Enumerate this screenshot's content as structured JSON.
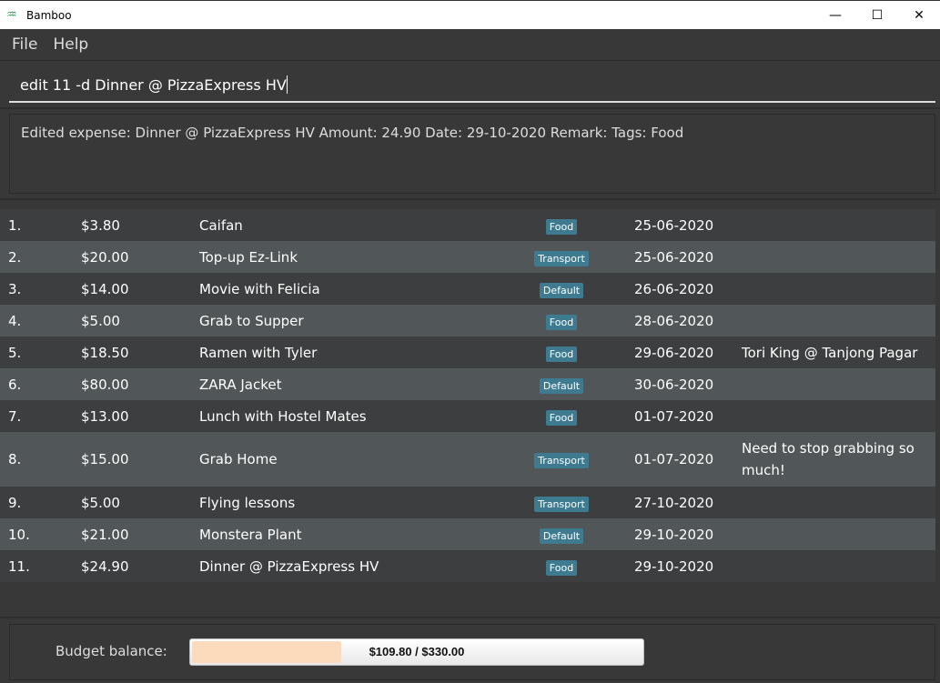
{
  "window": {
    "title": "Bamboo",
    "icon": "bamboo-icon",
    "controls": [
      "minimize-icon",
      "maximize-icon",
      "close-icon"
    ]
  },
  "menu": {
    "items": [
      "File",
      "Help"
    ]
  },
  "command": {
    "value": "edit 11 -d Dinner @ PizzaExpress HV"
  },
  "result": {
    "text": "Edited expense: Dinner @ PizzaExpress HV Amount: 24.90 Date: 29-10-2020 Remark:  Tags: Food"
  },
  "colors": {
    "tag": "#3e7b91",
    "budget_fill": "#fcdbbd",
    "row_odd": "#3c3e3f",
    "row_even": "#515658"
  },
  "expenses": [
    {
      "index": "1.",
      "amount": "$3.80",
      "description": "Caifan",
      "tag": "Food",
      "date": "25-06-2020",
      "remark": ""
    },
    {
      "index": "2.",
      "amount": "$20.00",
      "description": "Top-up Ez-Link",
      "tag": "Transport",
      "date": "25-06-2020",
      "remark": ""
    },
    {
      "index": "3.",
      "amount": "$14.00",
      "description": "Movie with Felicia",
      "tag": "Default",
      "date": "26-06-2020",
      "remark": ""
    },
    {
      "index": "4.",
      "amount": "$5.00",
      "description": "Grab to Supper",
      "tag": "Food",
      "date": "28-06-2020",
      "remark": ""
    },
    {
      "index": "5.",
      "amount": "$18.50",
      "description": "Ramen with Tyler",
      "tag": "Food",
      "date": "29-06-2020",
      "remark": "Tori King @ Tanjong Pagar"
    },
    {
      "index": "6.",
      "amount": "$80.00",
      "description": "ZARA Jacket",
      "tag": "Default",
      "date": "30-06-2020",
      "remark": ""
    },
    {
      "index": "7.",
      "amount": "$13.00",
      "description": "Lunch with Hostel Mates",
      "tag": "Food",
      "date": "01-07-2020",
      "remark": ""
    },
    {
      "index": "8.",
      "amount": "$15.00",
      "description": "Grab Home",
      "tag": "Transport",
      "date": "01-07-2020",
      "remark": "Need to stop grabbing so much!"
    },
    {
      "index": "9.",
      "amount": "$5.00",
      "description": "Flying lessons",
      "tag": "Transport",
      "date": "27-10-2020",
      "remark": ""
    },
    {
      "index": "10.",
      "amount": "$21.00",
      "description": "Monstera Plant",
      "tag": "Default",
      "date": "29-10-2020",
      "remark": ""
    },
    {
      "index": "11.",
      "amount": "$24.90",
      "description": "Dinner @ PizzaExpress HV",
      "tag": "Food",
      "date": "29-10-2020",
      "remark": ""
    }
  ],
  "budget": {
    "label": "Budget balance:",
    "text": "$109.80 / $330.00",
    "fraction": 0.3327
  }
}
